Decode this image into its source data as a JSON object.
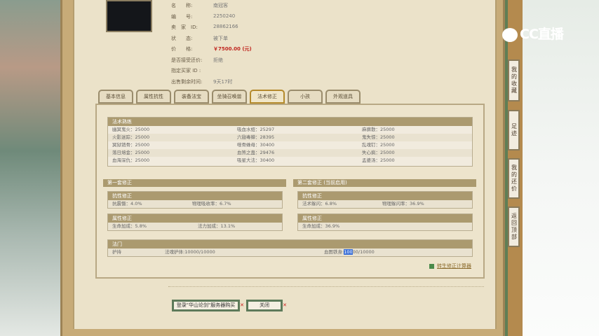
{
  "item": {
    "labels": [
      "名　　称:",
      "编　　号:",
      "卖　家　ID:",
      "状　　态:",
      "价　　格:",
      "是否接受还价:",
      "指定买家 ID :",
      "出售剩余时间:"
    ],
    "values": [
      "南冠客",
      "2250240",
      "28862166",
      "被下单",
      "￥7500.00 (元)",
      "拒绝",
      "",
      "9天17时"
    ]
  },
  "tabs": [
    "基本信息",
    "属性抗性",
    "装备法宝",
    "坐骑召唤兽",
    "法术修正",
    "小孩",
    "外观道具"
  ],
  "active_tab": "法术修正",
  "spell_skill": {
    "title": "法术熟练",
    "rows": [
      [
        "幽冥鬼火：25000",
        "吸血水蛭：25297",
        "麻痹散：25000"
      ],
      [
        "火影迷踪：25000",
        "六翅毒蝉：28395",
        "鬼失惊：25000"
      ],
      [
        "冥狱销骨：25000",
        "噬骨蛛母：30400",
        "乱魂钉：25000"
      ],
      [
        "落日熔金：25000",
        "血煞之蛊：29476",
        "失心疯：25000"
      ],
      [
        "血海深仇：25000",
        "吸星大法：30400",
        "孟婆汤：25000"
      ]
    ]
  },
  "set1": {
    "title": "第一套修正",
    "resist": {
      "title": "抗性修正",
      "a": "抗震慑：4.0%",
      "b": "物理吸收率：6.7%"
    },
    "attr": {
      "title": "属性修正",
      "a": "生命加成：5.8%",
      "b": "法力加成：13.1%"
    }
  },
  "set2": {
    "title": "第二套修正 (当前启用)",
    "resist": {
      "title": "抗性修正",
      "a": "法术躲闪：6.8%",
      "b": "物理躲闪率：36.9%"
    },
    "attr": {
      "title": "属性修正",
      "a": "生命加成：36.9%"
    }
  },
  "famen": {
    "title": "法门",
    "name": "护持",
    "a": "法魂护体:10000/10000",
    "b_pre": "血图铁身:",
    "b_sel": "100",
    "b_post": "00/10000"
  },
  "calc_link": "转生修正计算器",
  "buttons": {
    "buy": "登录\"华山论剑\"服务器购买",
    "close": "关闭"
  },
  "sidebar": [
    "我的收藏",
    "足迹",
    "我的还价",
    "返回顶部"
  ],
  "logo": "CC直播"
}
